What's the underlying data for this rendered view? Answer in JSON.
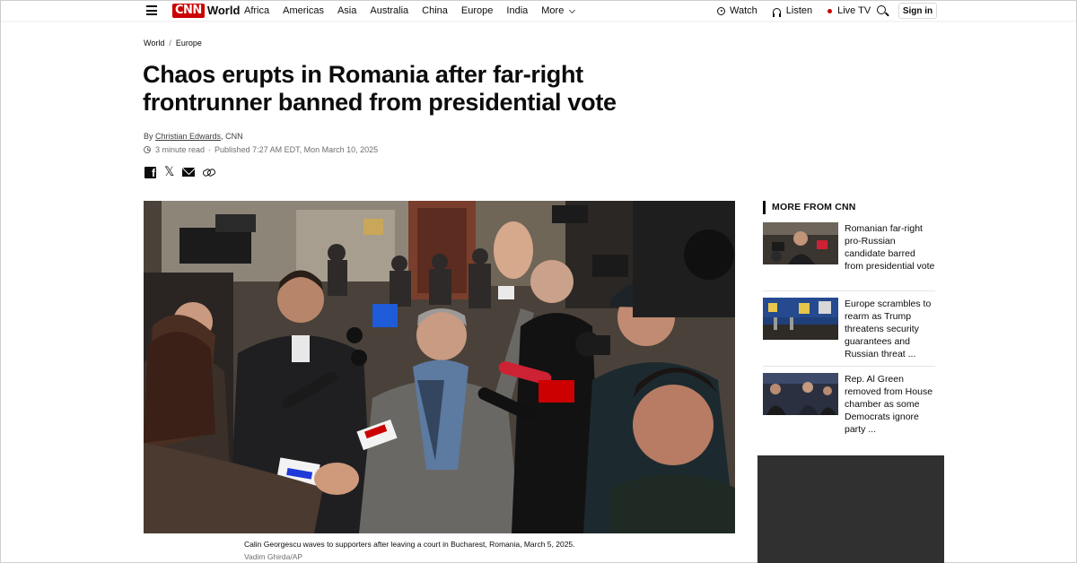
{
  "nav": {
    "logo": "CNN",
    "section": "World",
    "links": [
      "Africa",
      "Americas",
      "Asia",
      "Australia",
      "China",
      "Europe",
      "India"
    ],
    "more": "More",
    "watch": "Watch",
    "listen": "Listen",
    "live": "Live TV",
    "signin": "Sign in"
  },
  "breadcrumb": {
    "first": "World",
    "separator": "/",
    "second": "Europe"
  },
  "headline": "Chaos erupts in Romania after far-right frontrunner banned from presidential vote",
  "byline": {
    "prefix": "By",
    "author": "Christian Edwards",
    "outlet": ", CNN"
  },
  "meta": {
    "read_time": "3 minute read",
    "dot": "·",
    "published": "Published 7:27 AM EDT, Mon March 10, 2025"
  },
  "hero": {
    "caption": "Calin Georgescu waves to supporters after leaving a court in Bucharest, Romania, March 5, 2025.",
    "credit": "Vadim Ghirda/AP"
  },
  "sidebar": {
    "title": "MORE FROM CNN",
    "items": [
      {
        "text": "Romanian far-right pro-Russian candidate barred from presidential vote"
      },
      {
        "text": "Europe scrambles to rearm as Trump threatens security guarantees and Russian threat ..."
      },
      {
        "text": "Rep. Al Green removed from House chamber as some Democrats ignore party ..."
      }
    ]
  },
  "colors": {
    "brand": "#cc0000",
    "text": "#0c0c0c",
    "muted": "#6e6e6e",
    "ad": "#303030"
  }
}
